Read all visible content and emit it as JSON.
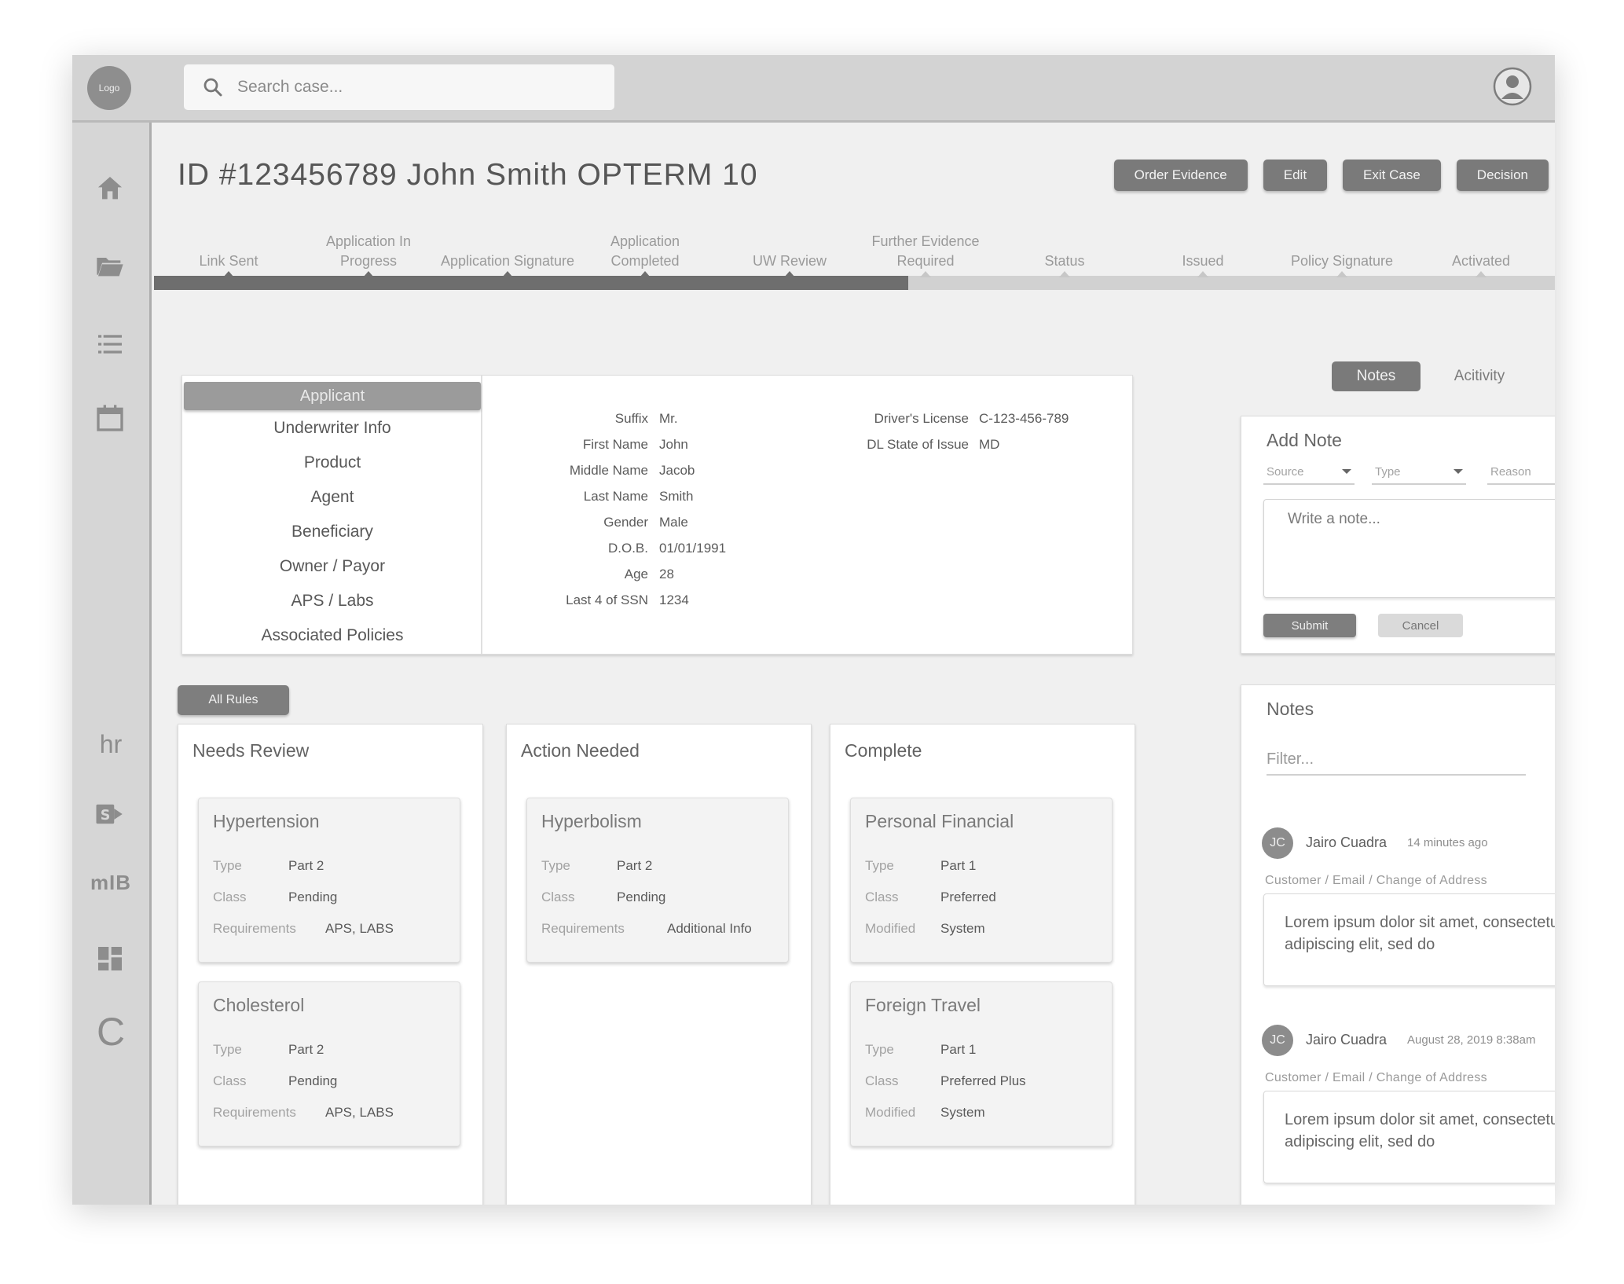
{
  "topbar": {
    "logo_text": "Logo",
    "search_placeholder": "Search case..."
  },
  "sidebar": {
    "icons": [
      "home-icon",
      "folder-icon",
      "list-icon",
      "calendar-icon"
    ],
    "apps": {
      "hr": "hr",
      "mib": "mIB",
      "c": "C"
    }
  },
  "page": {
    "title": "ID #123456789 John Smith OPTERM 10",
    "actions": {
      "order_evidence": "Order Evidence",
      "edit": "Edit",
      "exit_case": "Exit Case",
      "decision": "Decision"
    }
  },
  "progress": {
    "steps": [
      {
        "label": "Link Sent",
        "complete": true
      },
      {
        "label": "Application In Progress",
        "complete": true
      },
      {
        "label": "Application Signature",
        "complete": true
      },
      {
        "label": "Application Completed",
        "complete": true
      },
      {
        "label": "UW Review",
        "complete": true
      },
      {
        "label": "Further Evidence Required",
        "complete": false
      },
      {
        "label": "Status",
        "complete": false
      },
      {
        "label": "Issued",
        "complete": false
      },
      {
        "label": "Policy Signature",
        "complete": false
      },
      {
        "label": "Activated",
        "complete": false
      }
    ],
    "completed_count": 5
  },
  "applicant_nav": {
    "active": "Applicant",
    "items": [
      "Underwriter Info",
      "Product",
      "Agent",
      "Beneficiary",
      "Owner / Payor",
      "APS / Labs",
      "Associated Policies"
    ]
  },
  "applicant": {
    "fields": [
      {
        "label": "Suffix",
        "value": "Mr."
      },
      {
        "label": "First Name",
        "value": "John"
      },
      {
        "label": "Middle Name",
        "value": "Jacob"
      },
      {
        "label": "Last Name",
        "value": "Smith"
      },
      {
        "label": "Gender",
        "value": "Male"
      },
      {
        "label": "D.O.B.",
        "value": "01/01/1991"
      },
      {
        "label": "Age",
        "value": "28"
      },
      {
        "label": "Last 4 of SSN",
        "value": "1234"
      }
    ],
    "license": [
      {
        "label": "Driver's License",
        "value": "C-123-456-789"
      },
      {
        "label": "DL State of Issue",
        "value": "MD"
      }
    ]
  },
  "notes_tabs": {
    "notes": "Notes",
    "activity": "Acitivity"
  },
  "add_note": {
    "title": "Add Note",
    "source": "Source",
    "type": "Type",
    "reason": "Reason",
    "placeholder": "Write a note...",
    "submit": "Submit",
    "cancel": "Cancel"
  },
  "notes": {
    "title": "Notes",
    "filter_placeholder": "Filter...",
    "entries": [
      {
        "initials": "JC",
        "author": "Jairo Cuadra",
        "time": "14 minutes ago",
        "category": "Customer /  Email / Change of Address",
        "body": "Lorem ipsum dolor sit amet, consectetur adipiscing elit, sed do"
      },
      {
        "initials": "JC",
        "author": "Jairo Cuadra",
        "time": "August 28, 2019 8:38am",
        "category": "Customer /  Email / Change of Address",
        "body": "Lorem ipsum dolor sit amet, consectetur adipiscing elit, sed do"
      }
    ]
  },
  "rules": {
    "all_rules": "All Rules",
    "columns": [
      {
        "title": "Needs Review",
        "cards": [
          {
            "title": "Hypertension",
            "rows": [
              {
                "label": "Type",
                "value": "Part 2"
              },
              {
                "label": "Class",
                "value": "Pending"
              },
              {
                "label": "Requirements",
                "value": "APS, LABS"
              }
            ]
          },
          {
            "title": "Cholesterol",
            "rows": [
              {
                "label": "Type",
                "value": "Part 2"
              },
              {
                "label": "Class",
                "value": "Pending"
              },
              {
                "label": "Requirements",
                "value": "APS, LABS"
              }
            ]
          }
        ]
      },
      {
        "title": "Action Needed",
        "cards": [
          {
            "title": "Hyperbolism",
            "rows": [
              {
                "label": "Type",
                "value": "Part 2"
              },
              {
                "label": "Class",
                "value": "Pending"
              },
              {
                "label": "Requirements",
                "value": "Additional Info"
              }
            ]
          }
        ]
      },
      {
        "title": "Complete",
        "cards": [
          {
            "title": "Personal Financial",
            "rows": [
              {
                "label": "Type",
                "value": "Part 1"
              },
              {
                "label": "Class",
                "value": "Preferred"
              },
              {
                "label": "Modified",
                "value": "System"
              }
            ]
          },
          {
            "title": "Foreign Travel",
            "rows": [
              {
                "label": "Type",
                "value": "Part 1"
              },
              {
                "label": "Class",
                "value": "Preferred Plus"
              },
              {
                "label": "Modified",
                "value": "System"
              }
            ]
          }
        ]
      }
    ]
  }
}
